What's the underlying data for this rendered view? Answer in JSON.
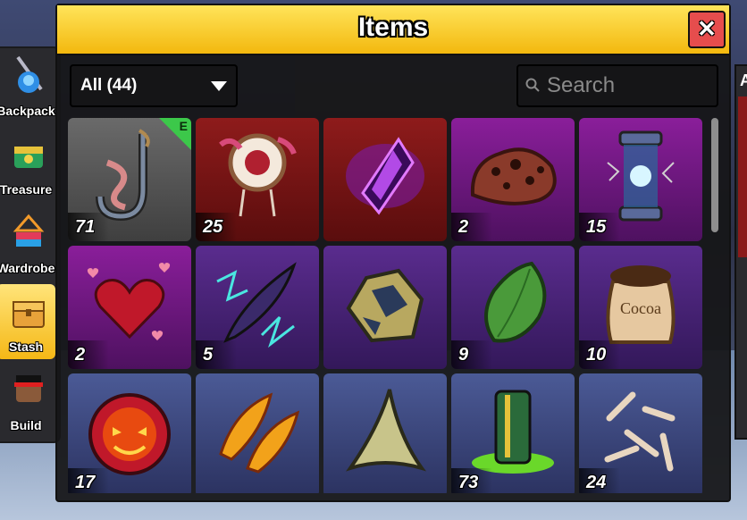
{
  "window": {
    "title": "Items",
    "close_label": "✕"
  },
  "filter": {
    "label": "All (44)"
  },
  "search": {
    "placeholder": "Search",
    "value": ""
  },
  "side_menu": [
    {
      "label": "Backpack",
      "name": "backpack"
    },
    {
      "label": "Treasure",
      "name": "treasure"
    },
    {
      "label": "Wardrobe",
      "name": "wardrobe"
    },
    {
      "label": "Stash",
      "name": "stash",
      "active": true
    },
    {
      "label": "Build",
      "name": "build"
    }
  ],
  "right_panel": {
    "glyph": "A"
  },
  "items": [
    {
      "icon": "fishing-hook-icon",
      "count": "71",
      "rarity": "gray",
      "equipped": true,
      "equip_label": "E"
    },
    {
      "icon": "dreamcatcher-icon",
      "count": "25",
      "rarity": "red"
    },
    {
      "icon": "dark-crystal-icon",
      "count": "",
      "rarity": "red"
    },
    {
      "icon": "meteorite-icon",
      "count": "2",
      "rarity": "purple"
    },
    {
      "icon": "energy-core-icon",
      "count": "15",
      "rarity": "purple"
    },
    {
      "icon": "hearts-icon",
      "count": "2",
      "rarity": "purple"
    },
    {
      "icon": "lightning-feather-icon",
      "count": "5",
      "rarity": "violet"
    },
    {
      "icon": "rock-ore-icon",
      "count": "",
      "rarity": "violet"
    },
    {
      "icon": "green-leaf-icon",
      "count": "9",
      "rarity": "violet"
    },
    {
      "icon": "cocoa-sack-icon",
      "count": "10",
      "rarity": "violet",
      "text": "Cocoa"
    },
    {
      "icon": "dark-fragment-icon",
      "count": "17",
      "rarity": "blue"
    },
    {
      "icon": "fire-feather-icon",
      "count": "",
      "rarity": "blue"
    },
    {
      "icon": "shark-tooth-icon",
      "count": "",
      "rarity": "blue"
    },
    {
      "icon": "slime-canister-icon",
      "count": "73",
      "rarity": "blue"
    },
    {
      "icon": "bones-icon",
      "count": "24",
      "rarity": "blue"
    }
  ],
  "colors": {
    "title_bar": "#f3b80e",
    "close": "#e64d4d",
    "equipped_badge": "#3cc84a"
  }
}
